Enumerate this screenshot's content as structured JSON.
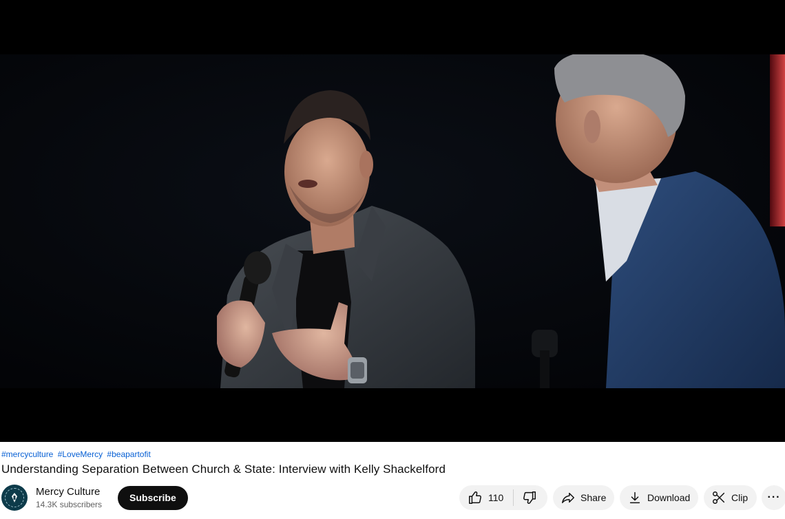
{
  "video": {
    "description": "Stage interview: speaker in dark jacket holding a microphone, second man in blue suit seen from behind at right",
    "colors": {
      "background": "#05070b",
      "accent_light": "#e84a4a"
    }
  },
  "hashtags": [
    "#mercyculture",
    "#LoveMercy",
    "#beapartofit"
  ],
  "title": "Understanding Separation Between Church & State: Interview with Kelly Shackelford",
  "channel": {
    "name": "Mercy Culture",
    "subscribers": "14.3K subscribers",
    "avatar_icon": "channel-logo-icon",
    "subscribe_label": "Subscribe"
  },
  "actions": {
    "like_count": "110",
    "like_icon": "thumbs-up-icon",
    "dislike_icon": "thumbs-down-icon",
    "share_label": "Share",
    "share_icon": "share-arrow-icon",
    "download_label": "Download",
    "download_icon": "download-icon",
    "clip_label": "Clip",
    "clip_icon": "scissors-icon",
    "more_label": "···"
  }
}
